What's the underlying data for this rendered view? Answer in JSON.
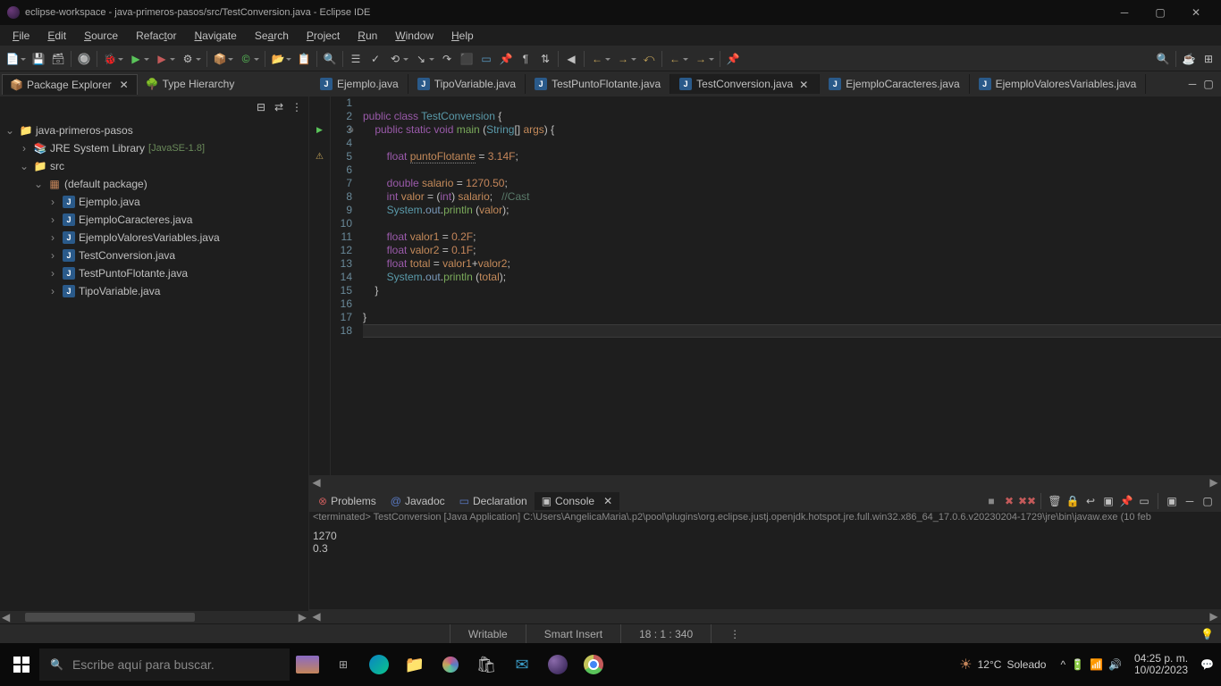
{
  "window": {
    "title": "eclipse-workspace - java-primeros-pasos/src/TestConversion.java - Eclipse IDE"
  },
  "menu": [
    "File",
    "Edit",
    "Source",
    "Refactor",
    "Navigate",
    "Search",
    "Project",
    "Run",
    "Window",
    "Help"
  ],
  "sidebar": {
    "tabs": [
      {
        "icon": "package-explorer-icon",
        "label": "Package Explorer",
        "active": true
      },
      {
        "icon": "type-hierarchy-icon",
        "label": "Type Hierarchy",
        "active": false
      }
    ],
    "tree": {
      "project": "java-primeros-pasos",
      "jre": "JRE System Library",
      "jre_dec": "[JavaSE-1.8]",
      "src": "src",
      "pkg": "(default package)",
      "files": [
        "Ejemplo.java",
        "EjemploCaracteres.java",
        "EjemploValoresVariables.java",
        "TestConversion.java",
        "TestPuntoFlotante.java",
        "TipoVariable.java"
      ]
    }
  },
  "editor": {
    "tabs": [
      {
        "label": "Ejemplo.java"
      },
      {
        "label": "TipoVariable.java"
      },
      {
        "label": "TestPuntoFlotante.java"
      },
      {
        "label": "TestConversion.java",
        "active": true
      },
      {
        "label": "EjemploCaracteres.java"
      },
      {
        "label": "EjemploValoresVariables.java"
      }
    ],
    "code": {
      "l2": {
        "a": "public class ",
        "b": "TestConversion",
        "c": " {"
      },
      "l3": {
        "a": "    public static void ",
        "b": "main",
        "c": " (",
        "d": "String",
        "e": "[] ",
        "f": "args",
        "g": ") {"
      },
      "l5": {
        "a": "        float ",
        "b": "puntoFlotante",
        "c": " = ",
        "d": "3.14F",
        "e": ";"
      },
      "l7": {
        "a": "        double ",
        "b": "salario",
        "c": " = ",
        "d": "1270.50",
        "e": ";"
      },
      "l8": {
        "a": "        int ",
        "b": "valor",
        "c": " = (",
        "d": "int",
        "e": ") ",
        "f": "salario",
        "g": ";   ",
        "h": "//Cast"
      },
      "l9": {
        "a": "        ",
        "b": "System",
        "c": ".",
        "d": "out",
        "e": ".",
        "f": "println",
        "g": " (",
        "h": "valor",
        "i": ");"
      },
      "l11": {
        "a": "        float ",
        "b": "valor1",
        "c": " = ",
        "d": "0.2F",
        "e": ";"
      },
      "l12": {
        "a": "        float ",
        "b": "valor2",
        "c": " = ",
        "d": "0.1F",
        "e": ";"
      },
      "l13": {
        "a": "        float ",
        "b": "total",
        "c": " = ",
        "d": "valor1",
        "e": "+",
        "f": "valor2",
        "g": ";"
      },
      "l14": {
        "a": "        ",
        "b": "System",
        "c": ".",
        "d": "out",
        "e": ".",
        "f": "println",
        "g": " (",
        "h": "total",
        "i": ");"
      },
      "l15": "    }",
      "l17": "}",
      "l18": ""
    }
  },
  "panel": {
    "tabs": [
      "Problems",
      "Javadoc",
      "Declaration",
      "Console"
    ],
    "console_head": "<terminated> TestConversion [Java Application] C:\\Users\\AngelicaMaria\\.p2\\pool\\plugins\\org.eclipse.justj.openjdk.hotspot.jre.full.win32.x86_64_17.0.6.v20230204-1729\\jre\\bin\\javaw.exe  (10 feb",
    "out": [
      "1270",
      "0.3"
    ]
  },
  "status": {
    "writable": "Writable",
    "insert": "Smart Insert",
    "pos": "18 : 1 : 340"
  },
  "taskbar": {
    "search_placeholder": "Escribe aquí para buscar.",
    "weather_temp": "12°C",
    "weather_cond": "Soleado",
    "time": "04:25 p. m.",
    "date": "10/02/2023"
  }
}
